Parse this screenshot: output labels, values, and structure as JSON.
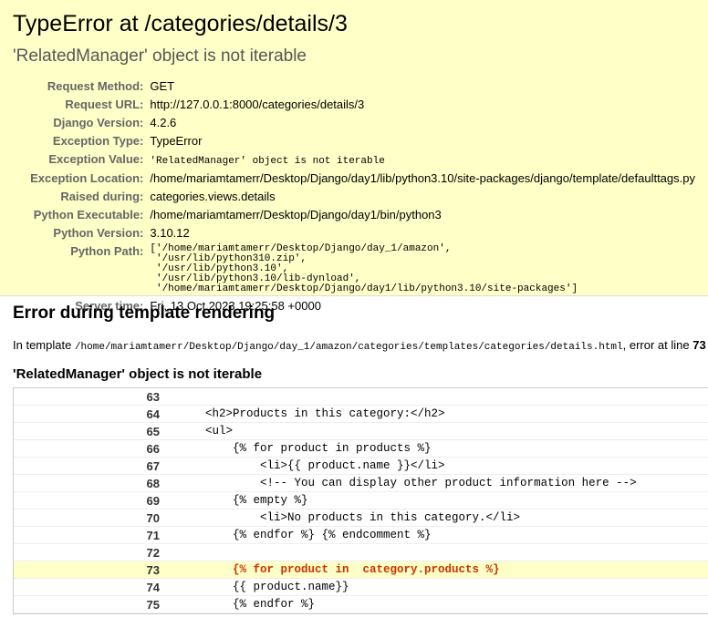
{
  "summary": {
    "title": "TypeError at /categories/details/3",
    "subtitle": "'RelatedManager' object is not iterable",
    "meta": [
      {
        "label": "Request Method:",
        "value": "GET"
      },
      {
        "label": "Request URL:",
        "value": "http://127.0.0.1:8000/categories/details/3"
      },
      {
        "label": "Django Version:",
        "value": "4.2.6"
      },
      {
        "label": "Exception Type:",
        "value": "TypeError"
      },
      {
        "label": "Exception Value:",
        "value": "'RelatedManager' object is not iterable"
      },
      {
        "label": "Exception Location:",
        "value": "/home/mariamtamerr/Desktop/Django/day1/lib/python3.10/site-packages/django/template/defaulttags.py"
      },
      {
        "label": "Raised during:",
        "value": "categories.views.details"
      },
      {
        "label": "Python Executable:",
        "value": "/home/mariamtamerr/Desktop/Django/day1/bin/python3"
      },
      {
        "label": "Python Version:",
        "value": "3.10.12"
      },
      {
        "label": "Python Path:",
        "value": "['/home/mariamtamerr/Desktop/Django/day_1/amazon',\n '/usr/lib/python310.zip',\n '/usr/lib/python3.10',\n '/usr/lib/python3.10/lib-dynload',\n '/home/mariamtamerr/Desktop/Django/day1/lib/python3.10/site-packages']"
      },
      {
        "label": "Server time:",
        "value": "Fri, 13 Oct 2023 19:25:58 +0000"
      }
    ]
  },
  "template": {
    "heading": "Error during template rendering",
    "info_prefix": "In template ",
    "path": "/home/mariamtamerr/Desktop/Django/day_1/amazon/categories/templates/categories/details.html",
    "info_mid": ", error at line ",
    "line": "73",
    "error_msg": "'RelatedManager' object is not iterable",
    "source_lines": [
      {
        "n": "63",
        "code": ""
      },
      {
        "n": "64",
        "code": "    <h2>Products in this category:</h2>"
      },
      {
        "n": "65",
        "code": "    <ul>"
      },
      {
        "n": "66",
        "code": "        {% for product in products %}"
      },
      {
        "n": "67",
        "code": "            <li>{{ product.name }}</li>"
      },
      {
        "n": "68",
        "code": "            <!-- You can display other product information here -->"
      },
      {
        "n": "69",
        "code": "        {% empty %}"
      },
      {
        "n": "70",
        "code": "            <li>No products in this category.</li>"
      },
      {
        "n": "71",
        "code": "        {% endfor %} {% endcomment %}"
      },
      {
        "n": "72",
        "code": ""
      },
      {
        "n": "73",
        "code": "        {% for product in  category.products %}",
        "error": true
      },
      {
        "n": "74",
        "code": "        {{ product.name}}"
      },
      {
        "n": "75",
        "code": "        {% endfor %}"
      }
    ]
  }
}
